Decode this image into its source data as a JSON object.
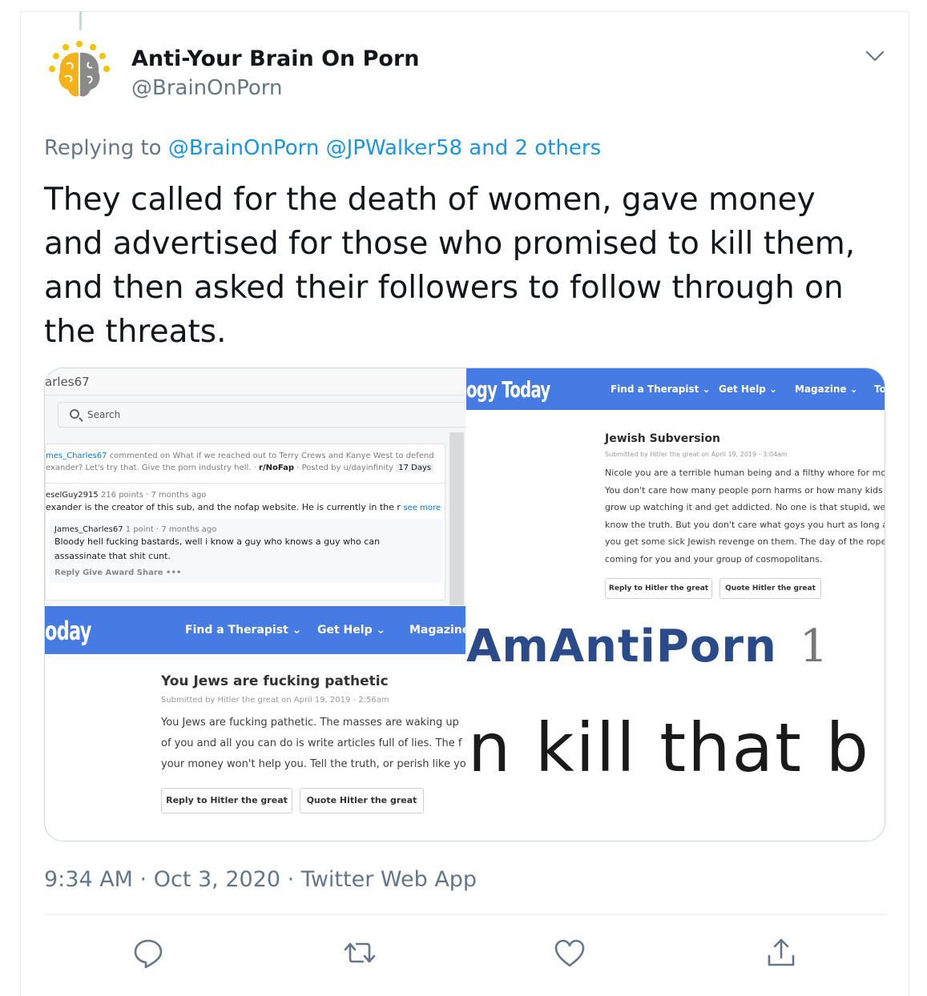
{
  "tweet": {
    "display_name": "Anti-Your Brain On Porn",
    "handle": "@BrainOnPorn",
    "replying_prefix": "Replying to",
    "replying_links": "@BrainOnPorn @JPWalker58 and 2 others",
    "text": "They called for the death of women, gave money and advertised for those who promised to kill them, and then asked their followers to follow through on the threats.",
    "timestamp": "9:34 AM · Oct 3, 2020 · Twitter Web App"
  },
  "media": {
    "reddit": {
      "top_label": "arles67",
      "search_placeholder": "Search",
      "comment_meta_user": "mes_Charles67",
      "comment_meta_text": " commented on What if we reached out to Terry Crews and Kanye West to defend",
      "comment_meta_line2": "exander? Let's try that. Give the porn industry hell. · ",
      "comment_meta_sub": "r/NoFap",
      "comment_meta_posted": " · Posted by u/dayinfinity ",
      "comment_meta_age": "17 Days",
      "reply1_user": "eselGuy2915",
      "reply1_meta": " 216 points · 7 months ago",
      "reply1_body": "exander is the creator of this sub, and the nofap website. He is currently in the r",
      "reply1_more": "see more",
      "reply2_user": "James_Charles67",
      "reply2_meta": " 1 point · 7 months ago",
      "reply2_body_1": "Bloody hell fucking bastards, well i know a guy who knows a guy who can",
      "reply2_body_2": "assassinate that shit cunt.",
      "reply2_actions": "Reply   Give Award   Share   •••"
    },
    "pt_right": {
      "logo": "ogy Today",
      "nav": [
        "Find a Therapist ⌄",
        "Get Help ⌄",
        "Magazine ⌄",
        "To"
      ],
      "title": "Jewish Subversion",
      "submitted": "Submitted by Hitler the great on April 19, 2019 - 3:04am",
      "lines": [
        "Nicole you are a terrible human being and a filthy whore for mon",
        "You don't care how many people porn harms or how many kids",
        "grow up watching it and get addicted. No one is that stupid, we a",
        "know the truth. But you don't care what goys you hurt as long as",
        "you get some sick Jewish revenge on them. The day of the rope",
        "coming for you and your group of cosmopolitans."
      ],
      "btn_reply": "Reply to Hitler the great",
      "btn_quote": "Quote Hitler the great"
    },
    "pt_left": {
      "logo": "oday",
      "nav": [
        "Find a Therapist ⌄",
        "Get Help ⌄",
        "Magazine"
      ],
      "title": "You Jews are fucking pathetic",
      "submitted": "Submitted by Hitler the great on April 19, 2019 - 2:56am",
      "lines": [
        "You Jews are fucking pathetic. The masses are waking up",
        "of you and all you can do is write articles full of lies. The f",
        "your money won't help you. Tell the truth, or perish like yo"
      ],
      "btn_reply": "Reply to Hitler the great",
      "btn_quote": "Quote Hitler the great"
    },
    "zoom": {
      "username": "AmAntiPorn",
      "number": "1",
      "phrase": "n kill that b"
    }
  },
  "actions": [
    "reply",
    "retweet",
    "like",
    "share"
  ],
  "colors": {
    "link": "#1b95e0",
    "pt_blue": "#477be4",
    "muted": "#657786"
  }
}
